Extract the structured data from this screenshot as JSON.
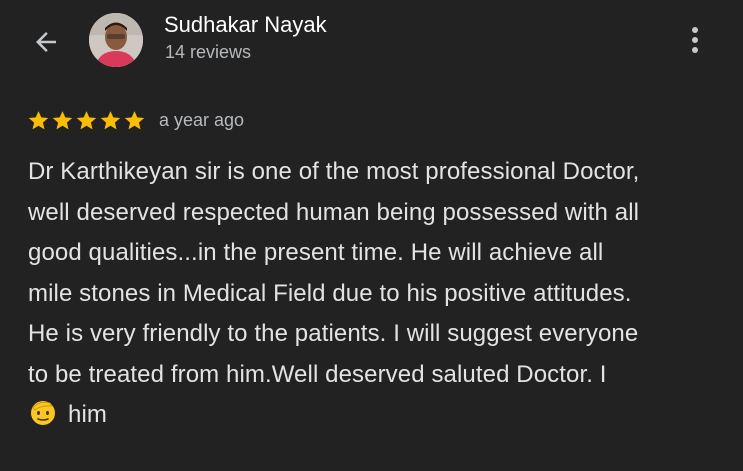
{
  "header": {
    "back_icon": "arrow-back-icon",
    "reviewer_name": "Sudhakar Nayak",
    "review_count": "14 reviews",
    "more_icon": "more-vertical-icon"
  },
  "review": {
    "rating": 5,
    "rating_max": 5,
    "star_color": "#fbbc04",
    "date": "a year ago",
    "lines": [
      "Dr Karthikeyan sir is one of the most professional Doctor,",
      "well deserved respected human being possessed with all",
      "good qualities...in the present time. He will achieve all",
      "mile stones in Medical Field due to his positive attitudes.",
      "He is very friendly to the patients. I will suggest everyone",
      "to be treated from him.Well deserved saluted Doctor. I"
    ],
    "last_line_emoji": "saluting-face-icon",
    "last_line_text": "him"
  },
  "colors": {
    "background": "#222222",
    "primary_text": "#ffffff",
    "secondary_text": "#b6b9bd",
    "body_text": "#e3e3e3"
  }
}
